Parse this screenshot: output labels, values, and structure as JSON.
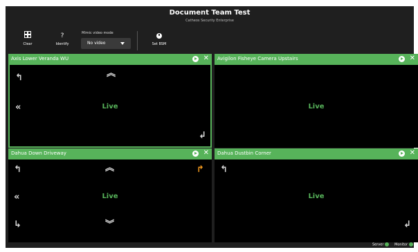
{
  "header": {
    "title": "Document Team Test",
    "subtitle": "Catheos Security Enterprise"
  },
  "toolbar": {
    "clear_label": "Clear",
    "identify_label": "Identify",
    "identify_icon": "?",
    "mimic_label": "Mimic video mode",
    "mimic_value": "No video",
    "set_bsm_label": "Set BSM"
  },
  "panels": [
    {
      "title": "Axis Lower Veranda WU",
      "status": "Live",
      "selected": true
    },
    {
      "title": "Avigilon Fisheye Camera Upstairs",
      "status": "Live",
      "selected": false
    },
    {
      "title": "Dahua Down Driveway",
      "status": "Live",
      "selected": false
    },
    {
      "title": "Dahua Dustbin Corner",
      "status": "Live",
      "selected": false
    }
  ],
  "status_bar": {
    "server_label": "Server",
    "monitor_label": "Monitor"
  },
  "colors": {
    "accent": "#57b35a",
    "background": "#1f1f1f",
    "ptz_active": "#f39a1e"
  },
  "icons": {
    "clear": "grid-icon",
    "identify": "question-icon",
    "set_bsm": "info-icon",
    "panel_play": "play-icon",
    "panel_close": "close-icon"
  }
}
